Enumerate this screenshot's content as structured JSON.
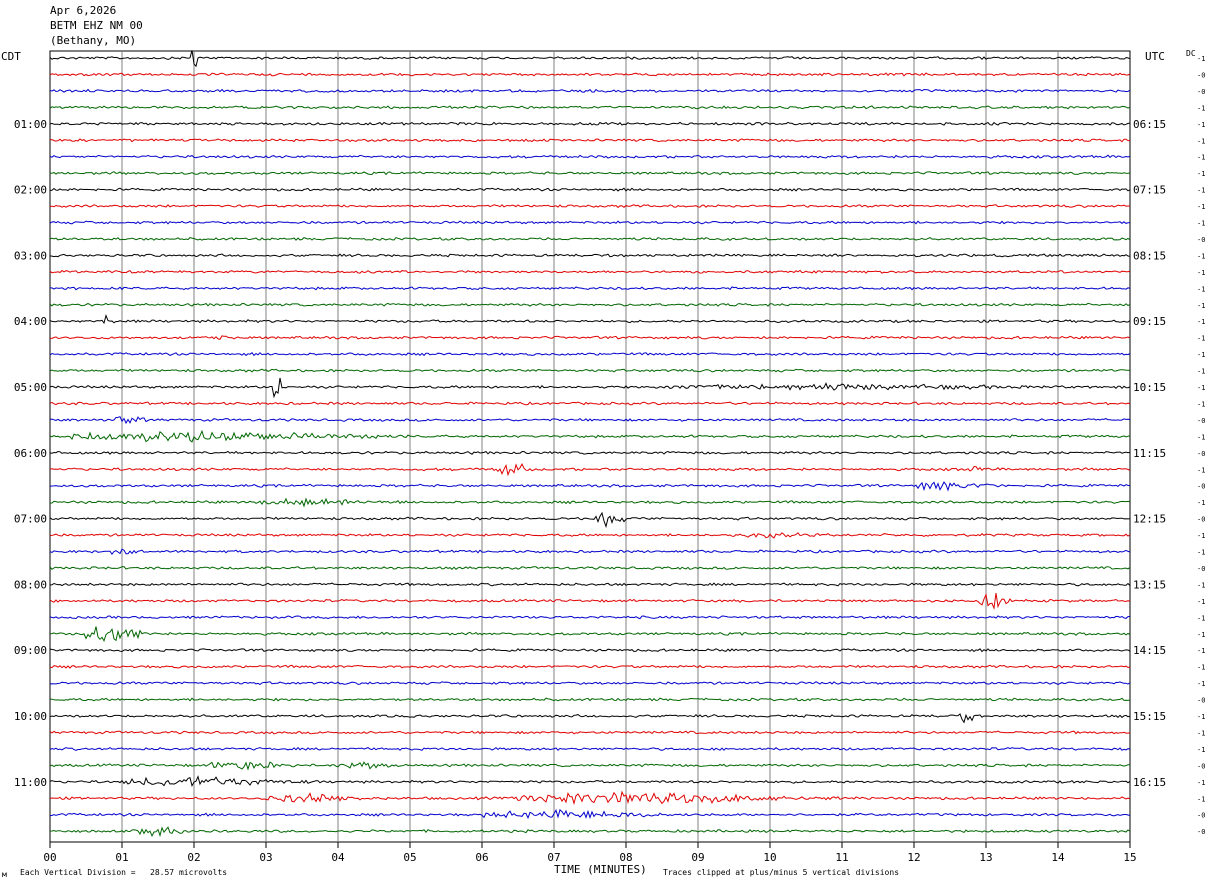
{
  "header": {
    "date": "Apr 6,2026",
    "station": "BETM EHZ NM 00",
    "location": "(Bethany, MO)"
  },
  "left_tz": "CDT",
  "right_tz": "UTC",
  "dc_label": "DC",
  "footer": {
    "scale_note": "Each Vertical Division =   28.57 microvolts",
    "xlabel": "TIME (MINUTES)",
    "clip_note": "Traces clipped at plus/minus 5 vertical divisions"
  },
  "colors": {
    "trace_cycle": [
      "#000000",
      "#e00000",
      "#0000cc",
      "#006600"
    ],
    "grid": "#808080"
  },
  "chart_data": {
    "type": "line",
    "title": "",
    "xlabel": "TIME (MINUTES)",
    "xlim": [
      0,
      15
    ],
    "x_ticks": [
      "00",
      "01",
      "02",
      "03",
      "04",
      "05",
      "06",
      "07",
      "08",
      "09",
      "10",
      "11",
      "12",
      "13",
      "14",
      "15"
    ],
    "left_hour_labels": [
      "01:00",
      "02:00",
      "03:00",
      "04:00",
      "05:00",
      "06:00",
      "07:00",
      "08:00",
      "09:00",
      "10:00",
      "11:00"
    ],
    "right_hour_labels": [
      "06:15",
      "07:15",
      "08:15",
      "09:15",
      "10:15",
      "11:15",
      "12:15",
      "13:15",
      "14:15",
      "15:15",
      "16:15"
    ],
    "dc_offsets": [
      "-1",
      "-0",
      "-0",
      "-1",
      "-1",
      "-1",
      "-1",
      "-1",
      "-1",
      "-1",
      "-1",
      "-0",
      "-1",
      "-1",
      "-1",
      "-1",
      "-1",
      "-1",
      "-1",
      "-1",
      "-1",
      "-1",
      "-0",
      "-1",
      "-0",
      "-1",
      "-0",
      "-1",
      "-0",
      "-1",
      "-1",
      "-0",
      "-1",
      "-1",
      "-1",
      "-1",
      "-1",
      "-1",
      "-1",
      "-0",
      "-1",
      "-1",
      "-1",
      "-0",
      "-1",
      "-1",
      "-0",
      "-0"
    ],
    "trace_count": 48,
    "noise_amplitude_divisions": 0.35,
    "events": [
      {
        "trace": 0,
        "minute": 1.95,
        "duration": 0.1,
        "amp": 5
      },
      {
        "trace": 16,
        "minute": 0.7,
        "duration": 0.2,
        "amp": 2.5
      },
      {
        "trace": 17,
        "minute": 2.3,
        "duration": 0.3,
        "amp": 1.5
      },
      {
        "trace": 20,
        "minute": 3.1,
        "duration": 0.1,
        "amp": 5
      },
      {
        "trace": 20,
        "minute": 8.5,
        "duration": 6.5,
        "amp": 1.3
      },
      {
        "trace": 22,
        "minute": 0.9,
        "duration": 0.5,
        "amp": 2
      },
      {
        "trace": 23,
        "minute": 0.3,
        "duration": 4.8,
        "amp": 2.2
      },
      {
        "trace": 25,
        "minute": 6.2,
        "duration": 0.5,
        "amp": 3.5
      },
      {
        "trace": 25,
        "minute": 12.6,
        "duration": 0.5,
        "amp": 2
      },
      {
        "trace": 26,
        "minute": 12.0,
        "duration": 1.2,
        "amp": 2
      },
      {
        "trace": 27,
        "minute": 2.8,
        "duration": 2.0,
        "amp": 1.5
      },
      {
        "trace": 28,
        "minute": 7.5,
        "duration": 0.6,
        "amp": 3
      },
      {
        "trace": 29,
        "minute": 9.5,
        "duration": 1.5,
        "amp": 1.3
      },
      {
        "trace": 30,
        "minute": 0.8,
        "duration": 0.5,
        "amp": 1.5
      },
      {
        "trace": 33,
        "minute": 12.9,
        "duration": 0.5,
        "amp": 3.5
      },
      {
        "trace": 35,
        "minute": 0.5,
        "duration": 0.9,
        "amp": 4
      },
      {
        "trace": 40,
        "minute": 12.6,
        "duration": 0.3,
        "amp": 3
      },
      {
        "trace": 43,
        "minute": 2.2,
        "duration": 1.4,
        "amp": 1.8
      },
      {
        "trace": 43,
        "minute": 4.0,
        "duration": 1.0,
        "amp": 1.5
      },
      {
        "trace": 44,
        "minute": 1.0,
        "duration": 2.8,
        "amp": 2
      },
      {
        "trace": 45,
        "minute": 3.0,
        "duration": 1.6,
        "amp": 1.8
      },
      {
        "trace": 45,
        "minute": 6.5,
        "duration": 4.5,
        "amp": 2.5
      },
      {
        "trace": 46,
        "minute": 6.0,
        "duration": 3.0,
        "amp": 1.8
      },
      {
        "trace": 47,
        "minute": 1.2,
        "duration": 0.9,
        "amp": 2
      }
    ]
  }
}
